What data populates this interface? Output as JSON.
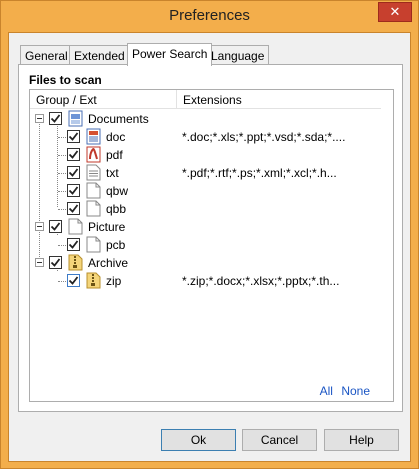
{
  "window": {
    "title": "Preferences",
    "close_label": "✕"
  },
  "tabs": [
    {
      "label": "General",
      "active": false
    },
    {
      "label": "Extended",
      "active": false
    },
    {
      "label": "Power Search",
      "active": true
    },
    {
      "label": "Language",
      "active": false
    }
  ],
  "panel": {
    "section_label": "Files to scan",
    "columns": {
      "group": "Group / Ext",
      "extensions": "Extensions"
    },
    "rows": [
      {
        "label": "Documents",
        "ext": "",
        "icon": "documents-icon",
        "checked": true,
        "level": 0
      },
      {
        "label": "doc",
        "ext": "*.doc;*.xls;*.ppt;*.vsd;*.sda;*....",
        "icon": "doc-file-icon",
        "checked": true,
        "level": 1
      },
      {
        "label": "pdf",
        "ext": "",
        "icon": "pdf-file-icon",
        "checked": true,
        "level": 1
      },
      {
        "label": "txt",
        "ext": "*.pdf;*.rtf;*.ps;*.xml;*.xcl;*.h...",
        "icon": "text-file-icon",
        "checked": true,
        "level": 1
      },
      {
        "label": "qbw",
        "ext": "",
        "icon": "blank-file-icon",
        "checked": true,
        "level": 1
      },
      {
        "label": "qbb",
        "ext": "",
        "icon": "blank-file-icon",
        "checked": true,
        "level": 1
      },
      {
        "label": "Picture",
        "ext": "",
        "icon": "blank-file-icon",
        "checked": true,
        "level": 0
      },
      {
        "label": "pcb",
        "ext": "",
        "icon": "blank-file-icon",
        "checked": true,
        "level": 1
      },
      {
        "label": "Archive",
        "ext": "",
        "icon": "archive-icon",
        "checked": true,
        "level": 0
      },
      {
        "label": "zip",
        "ext": "*.zip;*.docx;*.xlsx;*.pptx;*.th...",
        "icon": "zip-file-icon",
        "checked": true,
        "level": 1
      }
    ],
    "links": {
      "all": "All",
      "none": "None"
    }
  },
  "buttons": {
    "ok": "Ok",
    "cancel": "Cancel",
    "help": "Help"
  },
  "colors": {
    "titlebar": "#f3ae4b",
    "close": "#c7402e",
    "link": "#1a55c4",
    "check_blue": "#3d7bc7"
  }
}
